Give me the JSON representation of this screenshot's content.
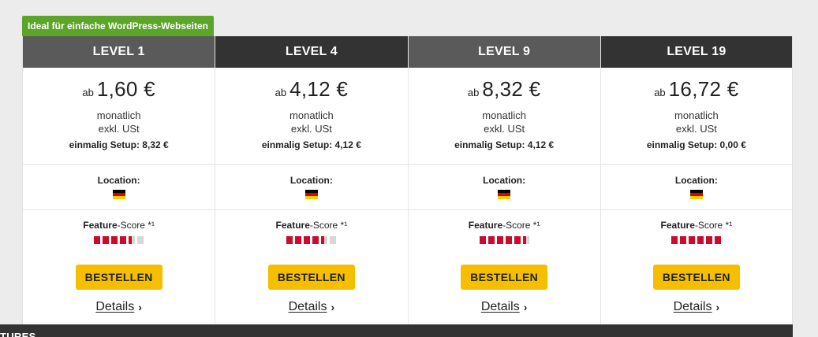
{
  "badge": "Ideal für einfache WordPress-Webseiten",
  "columns": [
    {
      "level": "LEVEL 1",
      "ab": "ab",
      "price": "1,60 €",
      "monthly": "monatlich",
      "tax": "exkl. USt",
      "setup": "einmalig Setup: 8,32 €",
      "location_label": "Location:",
      "feature_label": "Feature",
      "feature_suffix": "-Score *¹",
      "score_fraction": 0.75,
      "order": "BESTELLEN",
      "details": "Details",
      "header_style": "light"
    },
    {
      "level": "LEVEL 4",
      "ab": "ab",
      "price": "4,12 €",
      "monthly": "monatlich",
      "tax": "exkl. USt",
      "setup": "einmalig Setup: 4,12 €",
      "location_label": "Location:",
      "feature_label": "Feature",
      "feature_suffix": "-Score *¹",
      "score_fraction": 0.83,
      "order": "BESTELLEN",
      "details": "Details",
      "header_style": "dark"
    },
    {
      "level": "LEVEL 9",
      "ab": "ab",
      "price": "8,32 €",
      "monthly": "monatlich",
      "tax": "exkl. USt",
      "setup": "einmalig Setup: 4,12 €",
      "location_label": "Location:",
      "feature_label": "Feature",
      "feature_suffix": "-Score *¹",
      "score_fraction": 0.92,
      "order": "BESTELLEN",
      "details": "Details",
      "header_style": "light"
    },
    {
      "level": "LEVEL 19",
      "ab": "ab",
      "price": "16,72 €",
      "monthly": "monatlich",
      "tax": "exkl. USt",
      "setup": "einmalig Setup: 0,00 €",
      "location_label": "Location:",
      "feature_label": "Feature",
      "feature_suffix": "-Score *¹",
      "score_fraction": 1.0,
      "order": "BESTELLEN",
      "details": "Details",
      "header_style": "dark"
    }
  ],
  "footer_text": "TURES",
  "colors": {
    "accent_button": "#f5bf00",
    "score_on": "#cc0a2d",
    "badge": "#5da42a"
  },
  "icons": {
    "location_flag": "germany-flag-icon",
    "details_arrow": "chevron-right-icon"
  }
}
